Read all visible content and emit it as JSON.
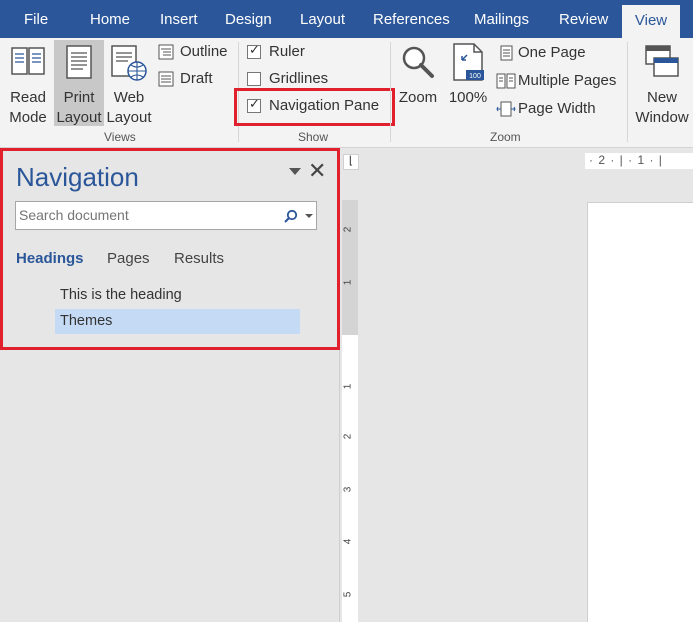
{
  "tabs": [
    "File",
    "Home",
    "Insert",
    "Design",
    "Layout",
    "References",
    "Mailings",
    "Review",
    "View"
  ],
  "active_tab": "View",
  "ribbon": {
    "views": {
      "read_mode": [
        "Read",
        "Mode"
      ],
      "print_layout": [
        "Print",
        "Layout"
      ],
      "web_layout": [
        "Web",
        "Layout"
      ],
      "outline": "Outline",
      "draft": "Draft",
      "group_label": "Views"
    },
    "show": {
      "ruler": "Ruler",
      "ruler_checked": true,
      "gridlines": "Gridlines",
      "gridlines_checked": false,
      "navigation_pane": "Navigation Pane",
      "navigation_pane_checked": true,
      "group_label": "Show"
    },
    "zoom": {
      "zoom": "Zoom",
      "hundred": "100%",
      "one_page": "One Page",
      "multiple_pages": "Multiple Pages",
      "page_width": "Page Width",
      "group_label": "Zoom"
    },
    "window": {
      "new_window": [
        "New",
        "Window"
      ]
    }
  },
  "navigation": {
    "title": "Navigation",
    "search_placeholder": "Search document",
    "tabs": [
      "Headings",
      "Pages",
      "Results"
    ],
    "active_tab": "Headings",
    "headings": [
      "This is the heading",
      "Themes"
    ],
    "selected_heading": "Themes"
  },
  "rulers": {
    "horizontal_marks": "· 2 · | · 1 · |",
    "vertical_marks": [
      "2",
      "1",
      "1",
      "2",
      "3",
      "4",
      "5"
    ]
  },
  "colors": {
    "accent": "#2b579a",
    "highlight_border": "#e0212d",
    "selected_heading_bg": "#c5daf5"
  }
}
